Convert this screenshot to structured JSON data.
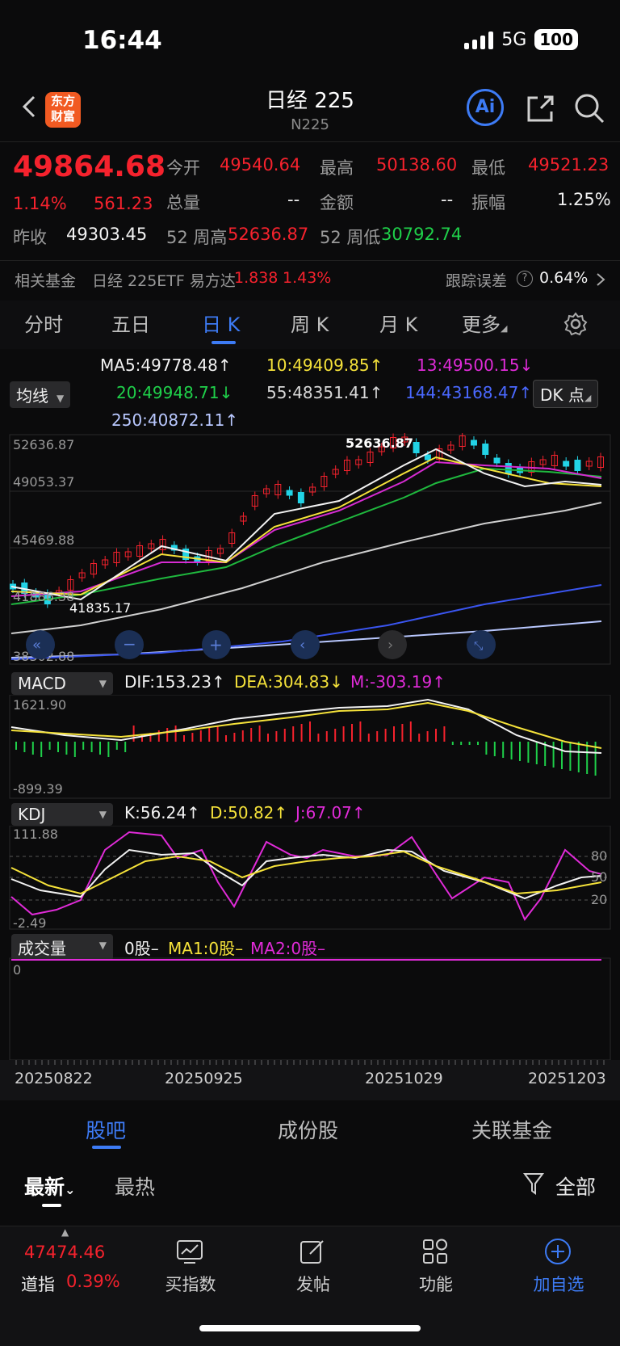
{
  "status": {
    "time": "16:44",
    "network": "5G",
    "battery": "100"
  },
  "nav": {
    "logo_line1": "东方",
    "logo_line2": "财富",
    "title": "日经 225",
    "subtitle": "N225",
    "ai_label": "Ai"
  },
  "quote": {
    "price": "49864.68",
    "change_pct": "1.14%",
    "change": "561.23",
    "open_label": "今开",
    "open": "49540.64",
    "high_label": "最高",
    "high": "50138.60",
    "low_label": "最低",
    "low": "49521.23",
    "volume_label": "总量",
    "volume": "--",
    "amount_label": "金额",
    "amount": "--",
    "amplitude_label": "振幅",
    "amplitude": "1.25%",
    "prev_label": "昨收",
    "prev": "49303.45",
    "wk52h_label": "52 周高",
    "wk52h": "52636.87",
    "wk52l_label": "52 周低",
    "wk52l": "30792.74"
  },
  "fund": {
    "label": "相关基金",
    "name": "日经 225ETF 易方达",
    "price": "1.838",
    "pct": "1.43%",
    "track_label": "跟踪误差",
    "track": "0.64%"
  },
  "ktabs": [
    "分时",
    "五日",
    "日 K",
    "周 K",
    "月 K",
    "更多"
  ],
  "ma_legend": {
    "selector": "均线",
    "dk": "DK 点",
    "ma5": "MA5:49778.48↑",
    "ma10": "10:49409.85↑",
    "ma13": "13:49500.15↓",
    "ma20": "20:49948.71↓",
    "ma55": "55:48351.41↑",
    "ma144": "144:43168.47↑",
    "ma250": "250:40872.11↑"
  },
  "kline": {
    "y_labels": [
      "52636.87",
      "49053.37",
      "45469.88",
      "41886.38",
      "38302.88"
    ],
    "max_mark": "52636.87",
    "min_mark": "41835.17"
  },
  "macd": {
    "selector": "MACD",
    "dif": "DIF:153.23↑",
    "dea": "DEA:304.83↓",
    "m": "M:-303.19↑",
    "top": "1621.90",
    "bottom": "-899.39"
  },
  "kdj": {
    "selector": "KDJ",
    "k": "K:56.24↑",
    "d": "D:50.82↑",
    "j": "J:67.07↑",
    "top": "111.88",
    "bottom": "-2.49",
    "levels": [
      "80",
      "50",
      "20"
    ]
  },
  "vol": {
    "selector": "成交量",
    "v": "0股–",
    "ma1": "MA1:0股–",
    "ma2": "MA2:0股–",
    "zero": "0"
  },
  "dates": [
    "20250822",
    "20250925",
    "20251029",
    "20251203"
  ],
  "section_tabs": [
    "股吧",
    "成份股",
    "关联基金"
  ],
  "feed": {
    "latest": "最新",
    "hot": "最热",
    "filter": "全部"
  },
  "tabbar": {
    "index_value": "47474.46",
    "index_name": "道指",
    "index_pct": "0.39%",
    "items": [
      "买指数",
      "发帖",
      "功能",
      "加自选"
    ]
  },
  "colors": {
    "up": "#f5222d",
    "down": "#1fd04a",
    "accent": "#3d7bf5",
    "cyan": "#22d3e6"
  }
}
